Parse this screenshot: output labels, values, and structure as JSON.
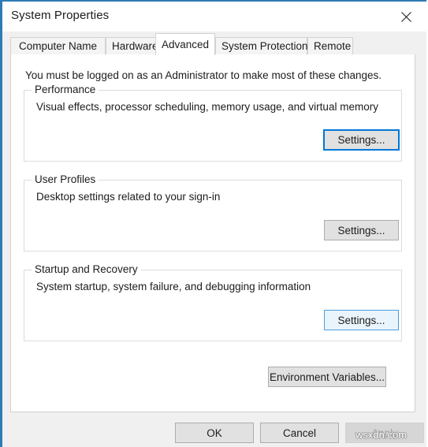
{
  "window": {
    "title": "System Properties",
    "close_icon": "close-icon",
    "accent_color": "#2f7ab5"
  },
  "tabs": [
    {
      "label": "Computer Name",
      "active": false
    },
    {
      "label": "Hardware",
      "active": false
    },
    {
      "label": "Advanced",
      "active": true
    },
    {
      "label": "System Protection",
      "active": false
    },
    {
      "label": "Remote",
      "active": false
    }
  ],
  "page": {
    "admin_note": "You must be logged on as an Administrator to make most of these changes.",
    "groups": [
      {
        "legend": "Performance",
        "description": "Visual effects, processor scheduling, memory usage, and virtual memory",
        "button_label": "Settings...",
        "button_state": "focused"
      },
      {
        "legend": "User Profiles",
        "description": "Desktop settings related to your sign-in",
        "button_label": "Settings...",
        "button_state": "normal"
      },
      {
        "legend": "Startup and Recovery",
        "description": "System startup, system failure, and debugging information",
        "button_label": "Settings...",
        "button_state": "hovered"
      }
    ],
    "environment_variables_label": "Environment Variables..."
  },
  "commands": {
    "ok_label": "OK",
    "cancel_label": "Cancel",
    "apply_label": "Apply",
    "apply_enabled": false
  },
  "watermark": {
    "text": "wsxdn.com"
  }
}
